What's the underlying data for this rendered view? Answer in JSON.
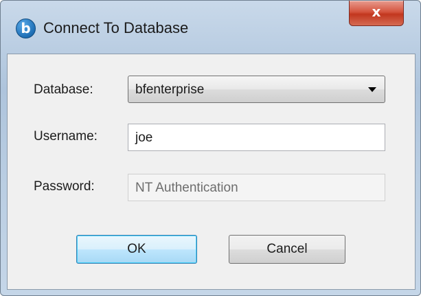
{
  "window": {
    "title": "Connect To Database",
    "close_glyph": "x",
    "app_icon_letter": "b"
  },
  "form": {
    "database_label": "Database:",
    "database_value": "bfenterprise",
    "username_label": "Username:",
    "username_value": "joe",
    "password_label": "Password:",
    "password_value": "NT Authentication"
  },
  "buttons": {
    "ok": "OK",
    "cancel": "Cancel"
  },
  "colors": {
    "titlebar": "#b9cde2",
    "close": "#c2371f",
    "client_bg": "#f0f0f0",
    "default_button": "#bee6fd"
  },
  "icons": {
    "app": "bigfix-logo-icon",
    "close": "close-icon",
    "dropdown": "chevron-down-icon"
  }
}
